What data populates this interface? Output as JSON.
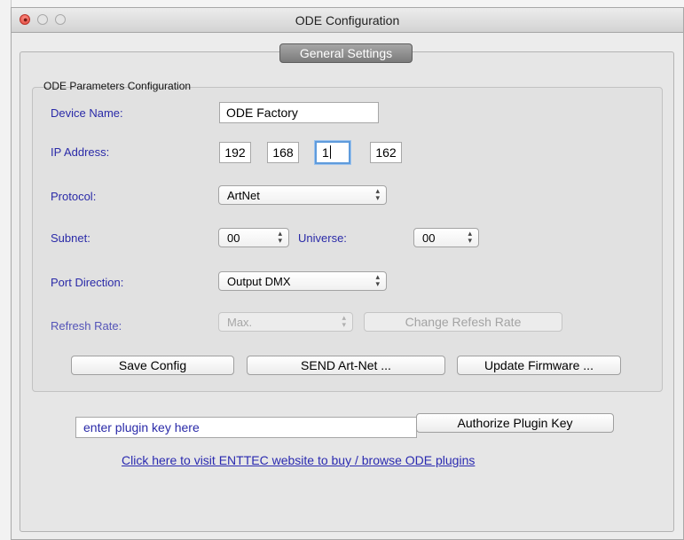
{
  "window": {
    "title": "ODE Configuration"
  },
  "tabs": {
    "general": "General Settings"
  },
  "group": {
    "title": "ODE Parameters Configuration"
  },
  "device_name": {
    "label": "Device Name:",
    "value": "ODE Factory"
  },
  "ip_address": {
    "label": "IP Address:",
    "octets": [
      "192",
      "168",
      "1",
      "162"
    ]
  },
  "protocol": {
    "label": "Protocol:",
    "value": "ArtNet"
  },
  "subnet": {
    "label": "Subnet:",
    "value": "00"
  },
  "universe": {
    "label": "Universe:",
    "value": "00"
  },
  "port_direction": {
    "label": "Port Direction:",
    "value": "Output DMX"
  },
  "refresh_rate": {
    "label": "Refresh Rate:",
    "value": "Max.",
    "change_button": "Change Refesh Rate"
  },
  "buttons": {
    "save": "Save Config",
    "send": "SEND Art-Net ...",
    "update": "Update Firmware ..."
  },
  "plugin": {
    "placeholder": "enter plugin key here",
    "authorize": "Authorize Plugin Key",
    "link": "Click here to visit ENTTEC website to buy / browse ODE plugins "
  },
  "colors": {
    "label_blue": "#2a2aa8",
    "focus_ring": "#5e9bdc",
    "tab_gray": "#8f8f8f"
  }
}
